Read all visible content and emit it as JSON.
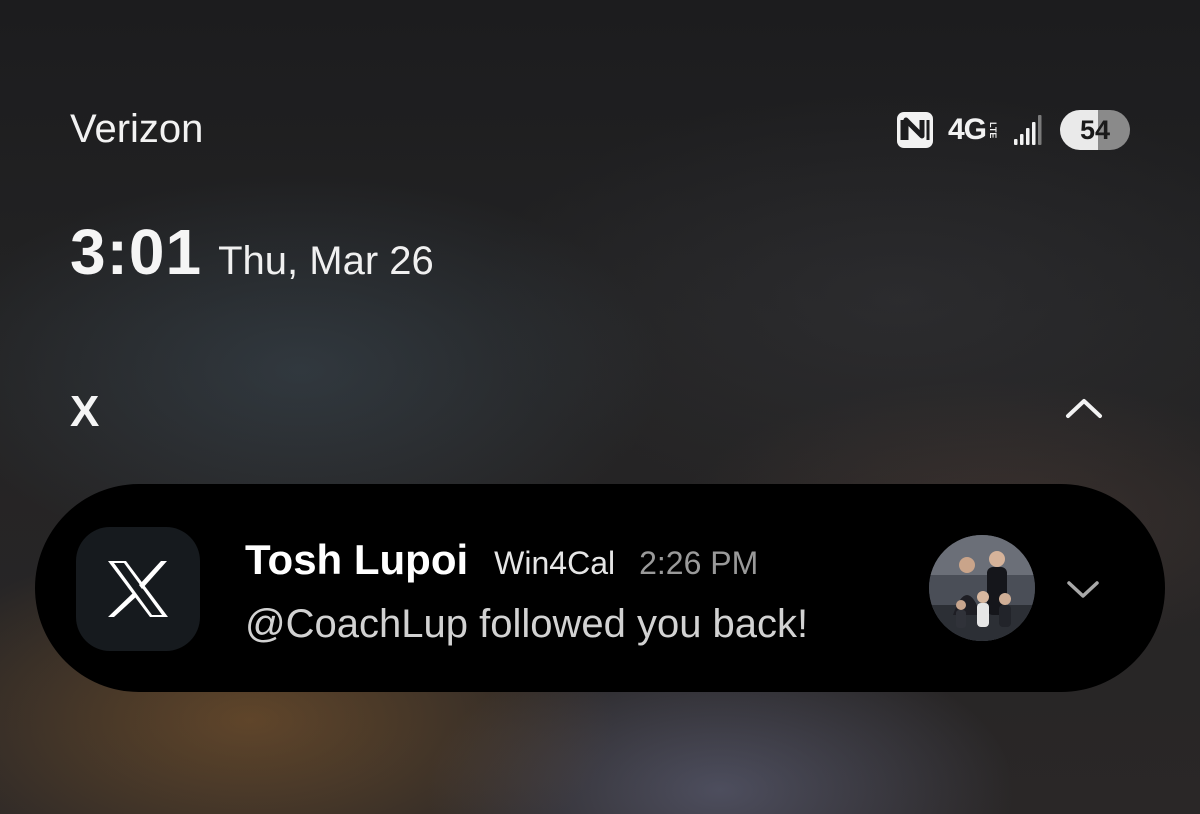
{
  "status_bar": {
    "carrier": "Verizon",
    "network_type": "4G",
    "network_subtype": "LTE",
    "battery_level": "54",
    "icons": [
      "nfc-icon",
      "signal-strength-icon"
    ]
  },
  "clock": {
    "time": "3:01",
    "date": "Thu, Mar 26"
  },
  "notification_group": {
    "app_name": "X",
    "collapse_icon": "chevron-up-icon"
  },
  "notification": {
    "app_icon": "x-logo-icon",
    "sender": "Tosh Lupoi",
    "account": "Win4Cal",
    "time": "2:26 PM",
    "message": "@CoachLup followed you back!",
    "expand_icon": "chevron-down-icon",
    "avatar": "profile-photo"
  },
  "colors": {
    "card_background": "#000000",
    "battery_fill": "#eaeaea",
    "timestamp": "#9a9a9a",
    "message_text": "#d2d2d2"
  }
}
